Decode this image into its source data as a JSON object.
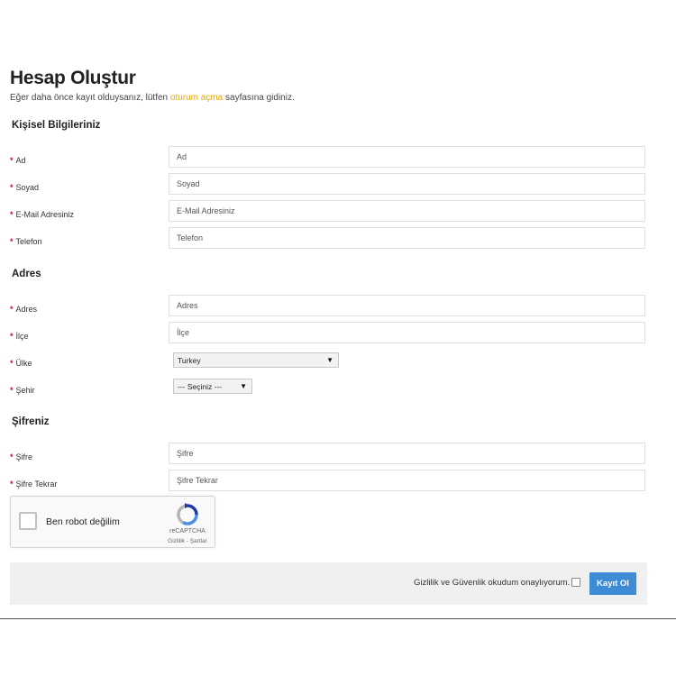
{
  "page": {
    "title": "Hesap Oluştur",
    "intro_before": "Eğer daha önce kayıt olduysanız, lütfen ",
    "intro_link": "oturum açma",
    "intro_after": " sayfasına gidiniz."
  },
  "personal": {
    "heading": "Kişisel Bilgileriniz",
    "ad": {
      "label": "Ad",
      "placeholder": "Ad"
    },
    "soyad": {
      "label": "Soyad",
      "placeholder": "Soyad"
    },
    "email": {
      "label": "E-Mail Adresiniz",
      "placeholder": "E-Mail Adresiniz"
    },
    "telefon": {
      "label": "Telefon",
      "placeholder": "Telefon"
    }
  },
  "address": {
    "heading": "Adres",
    "adres": {
      "label": "Adres",
      "placeholder": "Adres"
    },
    "ilce": {
      "label": "İlçe",
      "placeholder": "İlçe"
    },
    "ulke": {
      "label": "Ülke",
      "selected": "Turkey"
    },
    "sehir": {
      "label": "Şehir",
      "selected": "--- Seçiniz ---"
    }
  },
  "password": {
    "heading": "Şifreniz",
    "sifre": {
      "label": "Şifre",
      "placeholder": "Şifre"
    },
    "sifre_tekrar": {
      "label": "Şifre Tekrar",
      "placeholder": "Şifre Tekrar"
    }
  },
  "captcha": {
    "label": "Ben robot değilim",
    "brand": "reCAPTCHA",
    "links": "Gizlilik - Şartlar"
  },
  "footer": {
    "agree_text": "Gizlilik ve Güvenlik okudum onaylıyorum.",
    "submit_label": "Kayıt Ol"
  },
  "required_mark": "*",
  "colors": {
    "link": "#e8a800",
    "required": "#d9001b",
    "button": "#3d8bd5",
    "footer_bg": "#f0f0f0"
  }
}
